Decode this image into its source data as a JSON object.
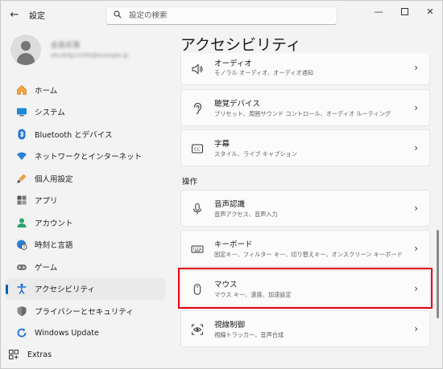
{
  "window": {
    "title": "設定"
  },
  "search": {
    "placeholder": "設定の検索"
  },
  "profile": {
    "name": "会員名簿",
    "email": "abcdefg12345@example.jp"
  },
  "nav": {
    "items": [
      {
        "label": "ホーム",
        "icon": "home-icon"
      },
      {
        "label": "システム",
        "icon": "system-icon"
      },
      {
        "label": "Bluetooth とデバイス",
        "icon": "bluetooth-icon"
      },
      {
        "label": "ネットワークとインターネット",
        "icon": "wifi-icon"
      },
      {
        "label": "個人用設定",
        "icon": "brush-icon"
      },
      {
        "label": "アプリ",
        "icon": "apps-icon"
      },
      {
        "label": "アカウント",
        "icon": "account-icon"
      },
      {
        "label": "時刻と言語",
        "icon": "globe-clock-icon"
      },
      {
        "label": "ゲーム",
        "icon": "gamepad-icon"
      },
      {
        "label": "アクセシビリティ",
        "icon": "accessibility-icon",
        "selected": true
      },
      {
        "label": "プライバシーとセキュリティ",
        "icon": "shield-icon"
      },
      {
        "label": "Windows Update",
        "icon": "update-icon"
      }
    ],
    "extras": "Extras"
  },
  "main": {
    "title": "アクセシビリティ",
    "cards_top": [
      {
        "title": "オーディオ",
        "subtitle": "モノラル オーディオ、オーディオ通知",
        "icon": "speaker-icon"
      },
      {
        "title": "聴覚デバイス",
        "subtitle": "プリセット、周囲サウンド コントロール、オーディオ ルーティング",
        "icon": "ear-icon"
      },
      {
        "title": "字幕",
        "subtitle": "スタイル、ライブ キャプション",
        "icon": "cc-icon"
      }
    ],
    "section_label": "操作",
    "cards_interaction": [
      {
        "title": "音声認識",
        "subtitle": "音声アクセス、音声入力",
        "icon": "microphone-icon"
      },
      {
        "title": "キーボード",
        "subtitle": "固定キー、フィルター キー、切り替えキー、オンスクリーン キーボード",
        "icon": "keyboard-icon"
      },
      {
        "title": "マウス",
        "subtitle": "マウス キー、速度、加速設定",
        "icon": "mouse-icon",
        "highlighted": true
      },
      {
        "title": "視線制御",
        "subtitle": "視線トラッカー、音声合成",
        "icon": "eye-control-icon"
      }
    ]
  },
  "colors": {
    "accent": "#005fb8",
    "highlight": "#e60012"
  }
}
